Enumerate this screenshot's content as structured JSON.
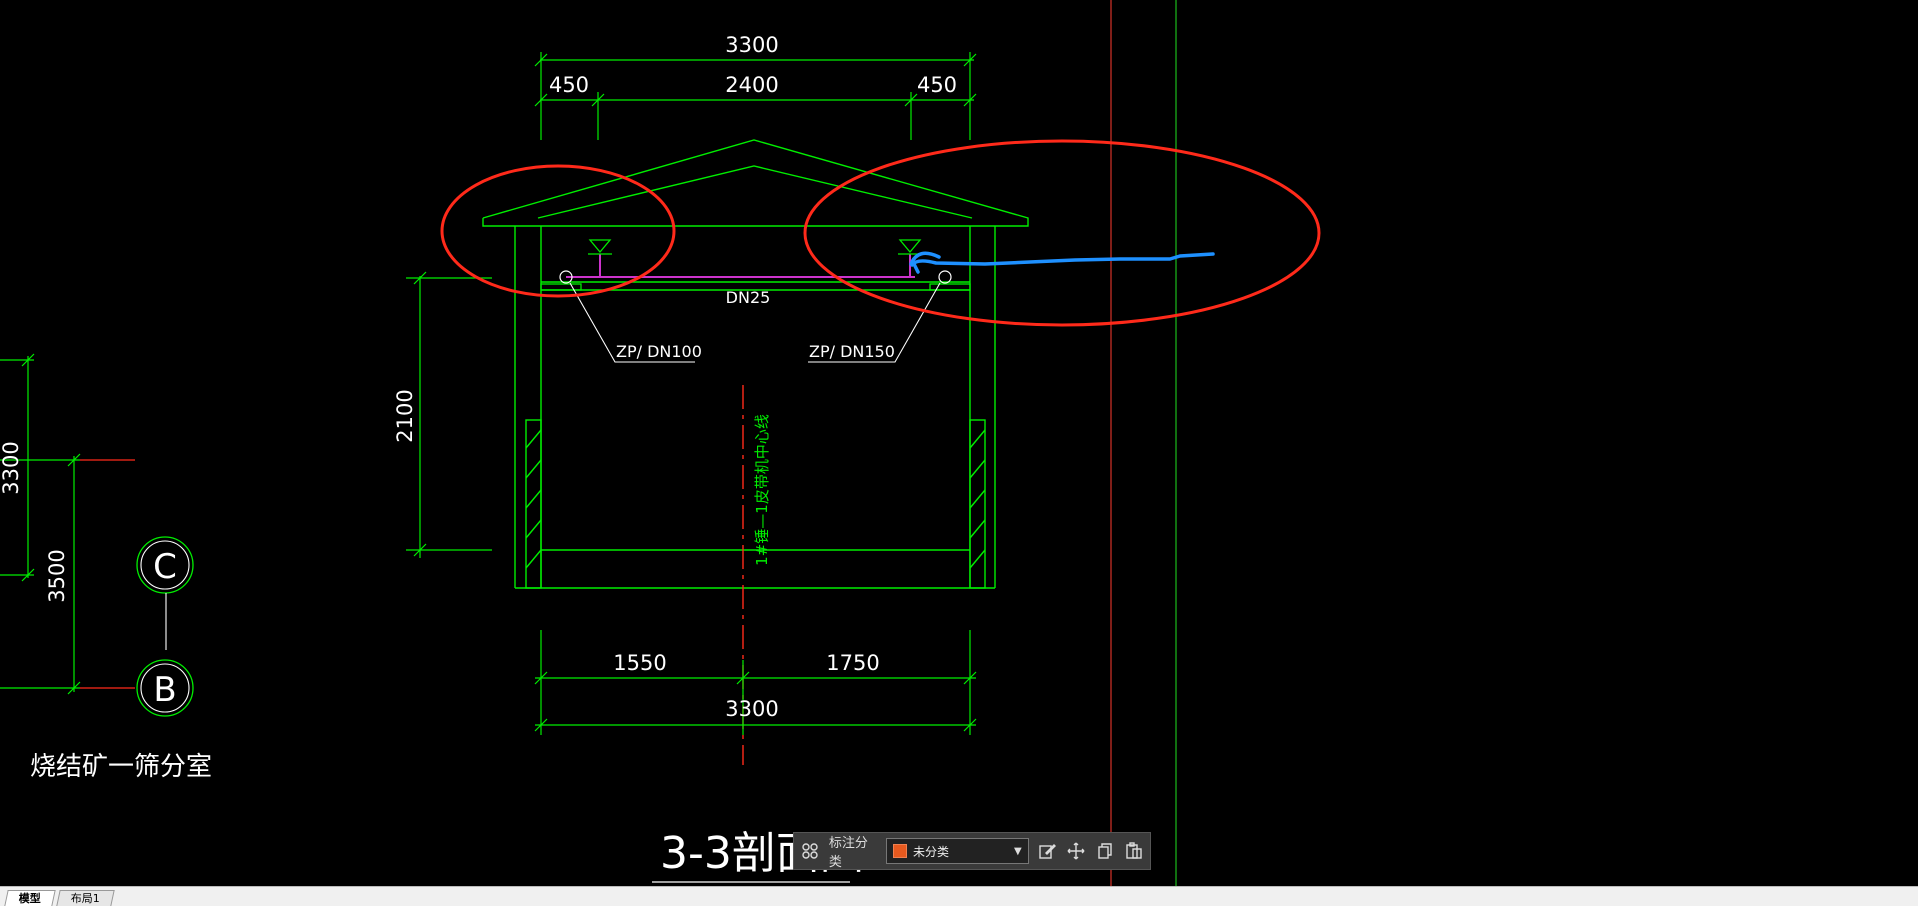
{
  "drawing": {
    "dims_top": {
      "overall": "3300",
      "left": "450",
      "middle": "2400",
      "right": "450"
    },
    "dims_bottom": {
      "left": "1550",
      "right": "1750",
      "overall": "3300"
    },
    "height_dim": "2100",
    "pipe_label": "DN25",
    "label_left": "ZP/ DN100",
    "label_right": "ZP/ DN150",
    "centerline_label": "1#锤—1皮带机中心线",
    "left_dims": {
      "upper": "3300",
      "lower": "3500"
    },
    "grid_c": "C",
    "grid_b": "B",
    "room_label": "烧结矿一筛分室",
    "section_title": "3-3剖面图"
  },
  "toolbar": {
    "label": "标注分类",
    "select_value": "未分类",
    "swatch_color": "#e85a1f"
  },
  "tabs": [
    "模型",
    "布局1"
  ],
  "colors": {
    "green": "#00ff00",
    "red": "#ff2a1a",
    "blue": "#1e90ff",
    "magenta": "#cc33cc",
    "white": "#ffffff"
  }
}
